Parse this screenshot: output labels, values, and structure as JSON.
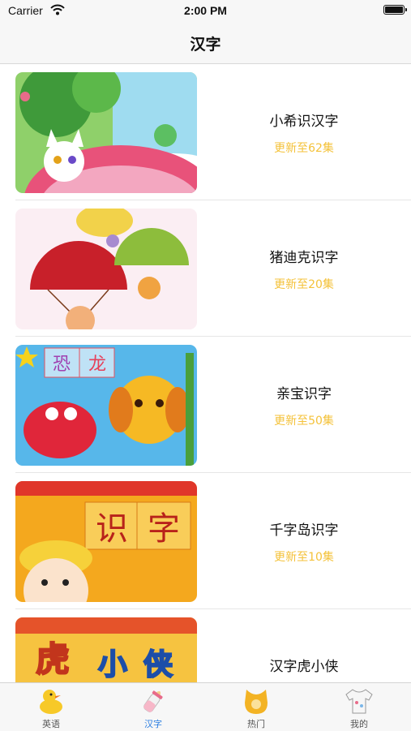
{
  "status_bar": {
    "carrier": "Carrier",
    "time": "2:00 PM"
  },
  "nav": {
    "title": "汉字"
  },
  "list": {
    "items": [
      {
        "title": "小希识汉字",
        "episodes": "更新至62集"
      },
      {
        "title": "猪迪克识字",
        "episodes": "更新至20集"
      },
      {
        "title": "亲宝识字",
        "episodes": "更新至50集"
      },
      {
        "title": "千字岛识字",
        "episodes": "更新至10集"
      },
      {
        "title": "汉字虎小侠",
        "episodes": ""
      }
    ]
  },
  "thumbnails": {
    "item3_chars": [
      "恐",
      "龙"
    ],
    "item4_chars": [
      "识",
      "字"
    ],
    "item5_chars": [
      "虎",
      "小",
      "侠"
    ]
  },
  "tabs": [
    {
      "label": "英语",
      "icon": "duck-icon",
      "active": false
    },
    {
      "label": "汉字",
      "icon": "baby-bottle-icon",
      "active": true
    },
    {
      "label": "热门",
      "icon": "bib-icon",
      "active": false
    },
    {
      "label": "我的",
      "icon": "baby-shirt-icon",
      "active": false
    }
  ],
  "colors": {
    "accent": "#2a7de1",
    "episodes": "#f4c23a"
  }
}
